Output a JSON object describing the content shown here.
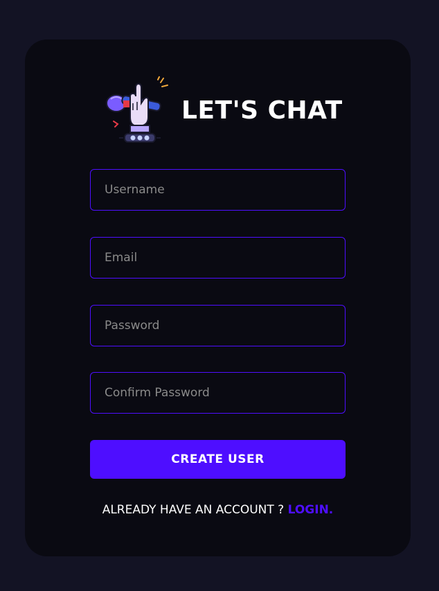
{
  "brand": {
    "title": "LET'S CHAT",
    "logo_icon": "microphone-hand-icon"
  },
  "form": {
    "username_placeholder": "Username",
    "username_value": "",
    "email_placeholder": "Email",
    "email_value": "",
    "password_placeholder": "Password",
    "password_value": "",
    "confirm_placeholder": "Confirm Password",
    "confirm_value": "",
    "submit_label": "CREATE USER"
  },
  "footer": {
    "prompt": "ALREADY HAVE AN ACCOUNT ? ",
    "login_label": "LOGIN."
  },
  "colors": {
    "page_bg": "#131324",
    "card_bg": "#0a0a12",
    "accent": "#4e0eff",
    "text": "#ffffff",
    "placeholder": "#8a8a8a"
  }
}
